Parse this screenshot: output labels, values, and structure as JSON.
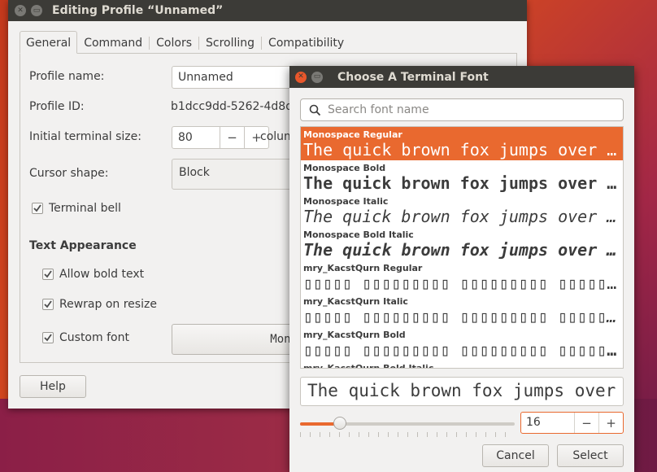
{
  "profile_window": {
    "title": "Editing Profile “Unnamed”",
    "tabs": [
      "General",
      "Command",
      "Colors",
      "Scrolling",
      "Compatibility"
    ],
    "active_tab": "General",
    "profile_name_label": "Profile name:",
    "profile_name_value": "Unnamed",
    "profile_id_label": "Profile ID:",
    "profile_id_value": "b1dcc9dd-5262-4d8d-a",
    "initial_size_label": "Initial terminal size:",
    "columns_value": "80",
    "columns_unit": "colum",
    "minus": "−",
    "plus": "+",
    "cursor_shape_label": "Cursor shape:",
    "cursor_shape_value": "Block",
    "terminal_bell_label": "Terminal bell",
    "text_appearance_title": "Text Appearance",
    "allow_bold_label": "Allow bold text",
    "rewrap_label": "Rewrap on resize",
    "custom_font_label": "Custom font",
    "custom_font_button": "Mono",
    "help_button": "Help",
    "checks": {
      "terminal_bell": true,
      "allow_bold": true,
      "rewrap": true,
      "custom_font": true
    }
  },
  "font_dialog": {
    "title": "Choose A Terminal Font",
    "search_placeholder": "Search font name",
    "fonts": [
      {
        "name": "Monospace Regular",
        "sample": "The quick brown fox jumps over the lazy dog",
        "style": "regular"
      },
      {
        "name": "Monospace Bold",
        "sample": "The quick brown fox jumps over the lazy dog",
        "style": "bold"
      },
      {
        "name": "Monospace Italic",
        "sample": "The quick brown fox jumps over the lazy dog",
        "style": "italic"
      },
      {
        "name": "Monospace Bold Italic",
        "sample": "The quick brown fox jumps over the lazy dog",
        "style": "bolditalic"
      },
      {
        "name": "mry_KacstQurn Regular",
        "sample": "▯▯▯▯▯ ▯▯▯▯▯▯▯▯▯ ▯▯▯▯▯▯▯▯▯ ▯▯▯▯▯ ▯▯▯▯▯▯▯▯",
        "style": "regular"
      },
      {
        "name": "mry_KacstQurn Italic",
        "sample": "▯▯▯▯▯ ▯▯▯▯▯▯▯▯▯ ▯▯▯▯▯▯▯▯▯ ▯▯▯▯▯ ▯▯▯▯▯▯▯▯",
        "style": "italic"
      },
      {
        "name": "mry_KacstQurn Bold",
        "sample": "▯▯▯▯▯ ▯▯▯▯▯▯▯▯▯ ▯▯▯▯▯▯▯▯▯ ▯▯▯▯▯ ▯▯▯▯▯▯▯▯",
        "style": "bold"
      },
      {
        "name": "mry_KacstQurn Bold Italic",
        "sample": "▯▯▯▯▯ ▯▯▯▯▯▯▯▯▯ ▯▯▯▯▯▯▯▯▯",
        "style": "bolditalic"
      }
    ],
    "selected_index": 0,
    "preview_text": "The quick brown fox jumps over the lazy dog",
    "size_value": "16",
    "size_fraction": 0.165,
    "minus": "−",
    "plus": "+",
    "cancel_button": "Cancel",
    "select_button": "Select"
  },
  "colors": {
    "accent": "#e9692f",
    "titlebar": "#3c3b37",
    "close": "#e9572b"
  }
}
